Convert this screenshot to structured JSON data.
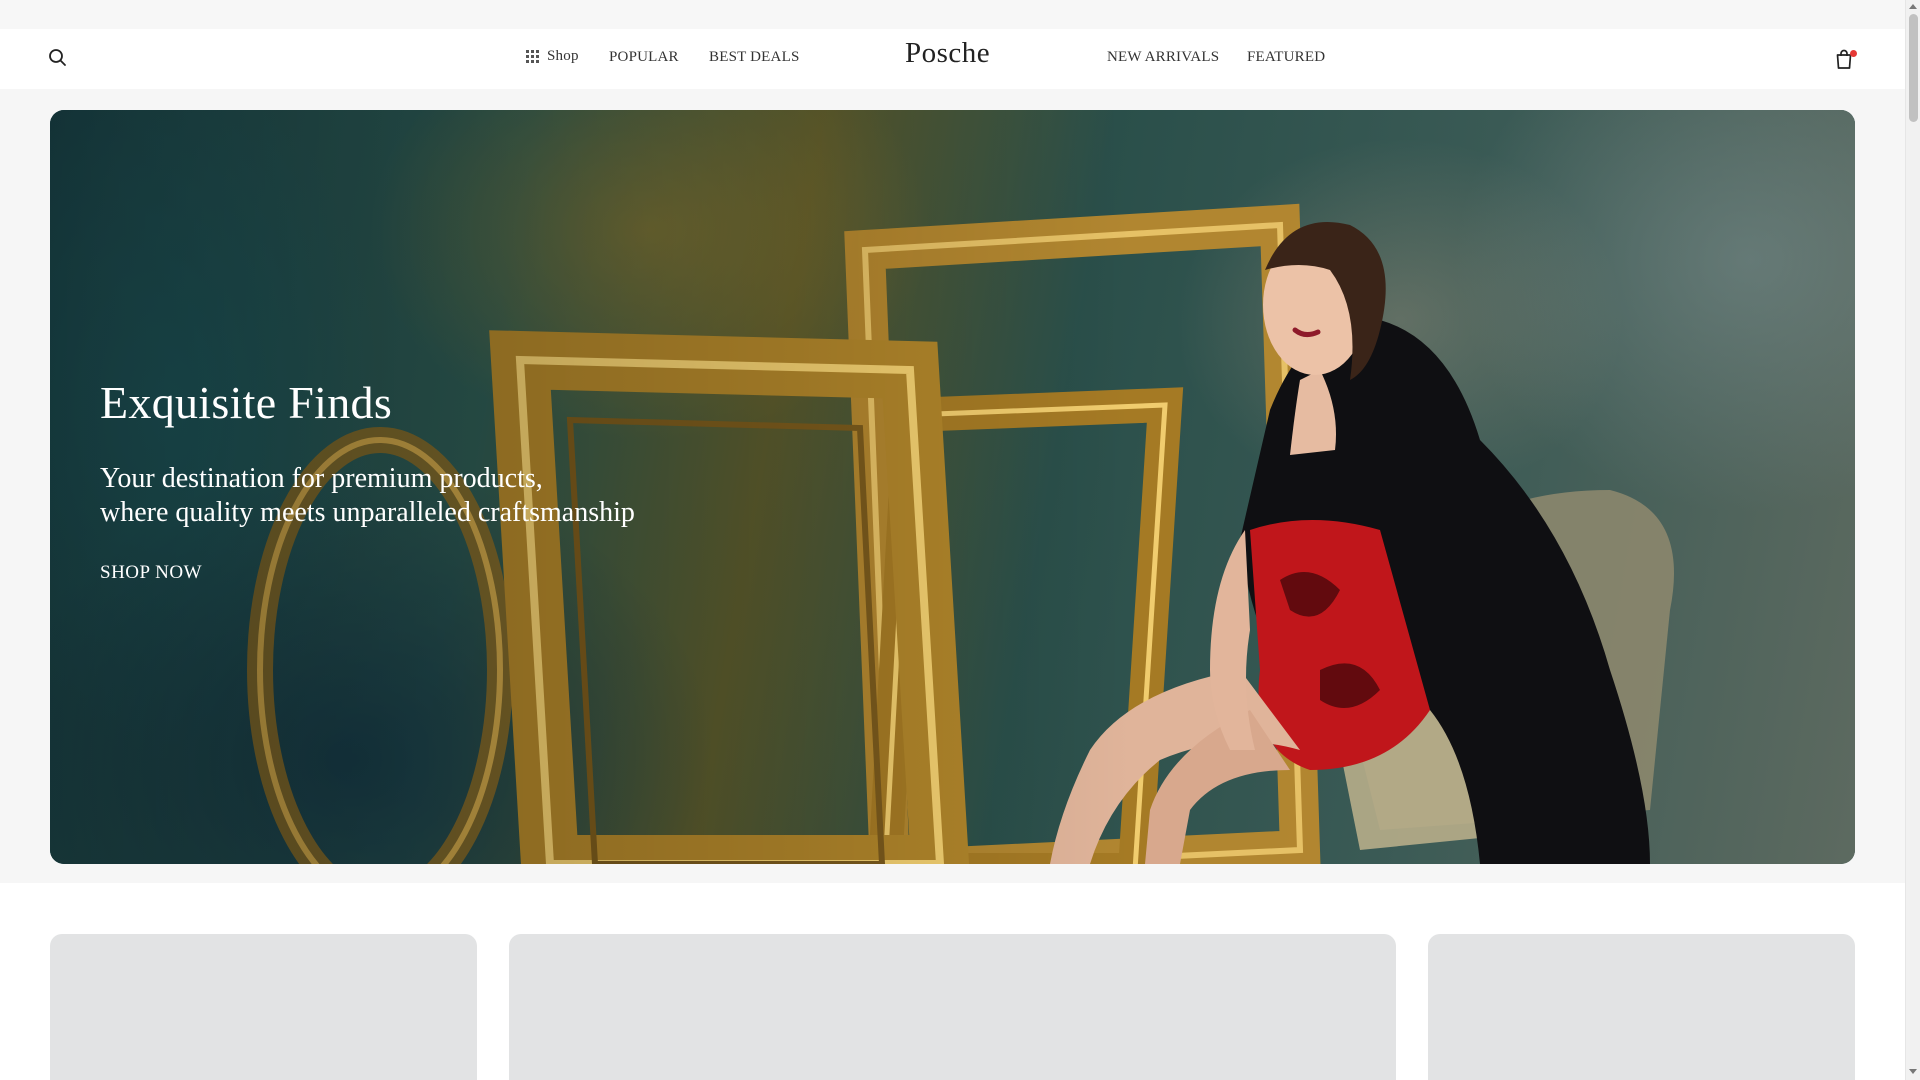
{
  "header": {
    "brand": "Posche",
    "nav_left": [
      "Shop",
      "POPULAR",
      "BEST DEALS"
    ],
    "nav_right": [
      "NEW ARRIVALS",
      "FEATURED"
    ],
    "icons": {
      "search": "search-icon",
      "shop": "grid-icon",
      "cart": "shopping-bag-icon"
    },
    "cart_badge_color": "#e53935"
  },
  "hero": {
    "title": "Exquisite Finds",
    "subtitle_line1": "Your destination for premium products,",
    "subtitle_line2": "where quality meets unparalleled craftsmanship",
    "cta": "SHOP NOW"
  },
  "cards": [
    {
      "name": "product-card-1"
    },
    {
      "name": "product-card-2"
    },
    {
      "name": "product-card-3"
    }
  ],
  "colors": {
    "header_bg": "#ffffff",
    "page_bg": "#f6f6f6",
    "placeholder": "#e2e3e4",
    "hero_text": "#ffffff"
  }
}
